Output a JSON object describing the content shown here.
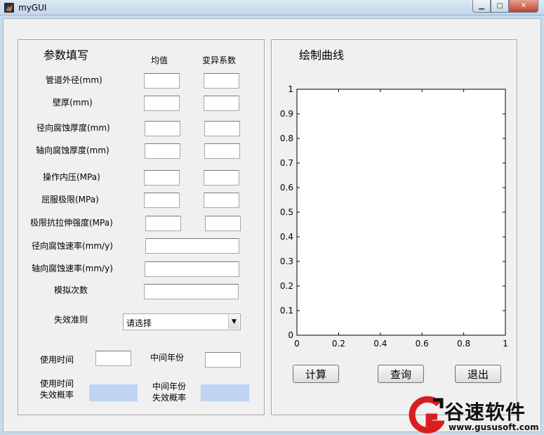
{
  "window": {
    "title": "myGUI"
  },
  "params_panel": {
    "title": "参数填写",
    "col_mean": "均值",
    "col_cv": "变异系数",
    "rows": [
      "管道外径(mm)",
      "壁厚(mm)",
      "径向腐蚀厚度(mm)",
      "轴向腐蚀厚度(mm)",
      "操作内压(MPa)",
      "屈服极限(MPa)",
      "极限抗拉伸强度(MPa)",
      "径向腐蚀速率(mm/y)",
      "轴向腐蚀速率(mm/y)",
      "模拟次数"
    ],
    "criterion_label": "失效准则",
    "criterion_value": "请选择",
    "use_time_label": "使用时间",
    "mid_year_label": "中间年份",
    "use_time_prob_label_1": "使用时间",
    "use_time_prob_label_2": "失效概率",
    "mid_year_prob_label_1": "中间年份",
    "mid_year_prob_label_2": "失效概率"
  },
  "plot_panel": {
    "title": "绘制曲线",
    "buttons": {
      "compute": "计算",
      "query": "查询",
      "exit": "退出"
    }
  },
  "chart_data": {
    "type": "line",
    "title": "",
    "xlabel": "",
    "ylabel": "",
    "xlim": [
      0,
      1
    ],
    "ylim": [
      0,
      1
    ],
    "x_ticks": [
      "0",
      "0.2",
      "0.4",
      "0.6",
      "0.8",
      "1"
    ],
    "y_ticks": [
      "0",
      "0.1",
      "0.2",
      "0.3",
      "0.4",
      "0.5",
      "0.6",
      "0.7",
      "0.8",
      "0.9",
      "1"
    ],
    "series": [],
    "grid": false
  },
  "watermark": {
    "brand": "谷速软件",
    "url": "www.gususoft.com"
  },
  "colors": {
    "output_box": "#bdd5f3",
    "panel_bg": "#f0f0f0"
  }
}
